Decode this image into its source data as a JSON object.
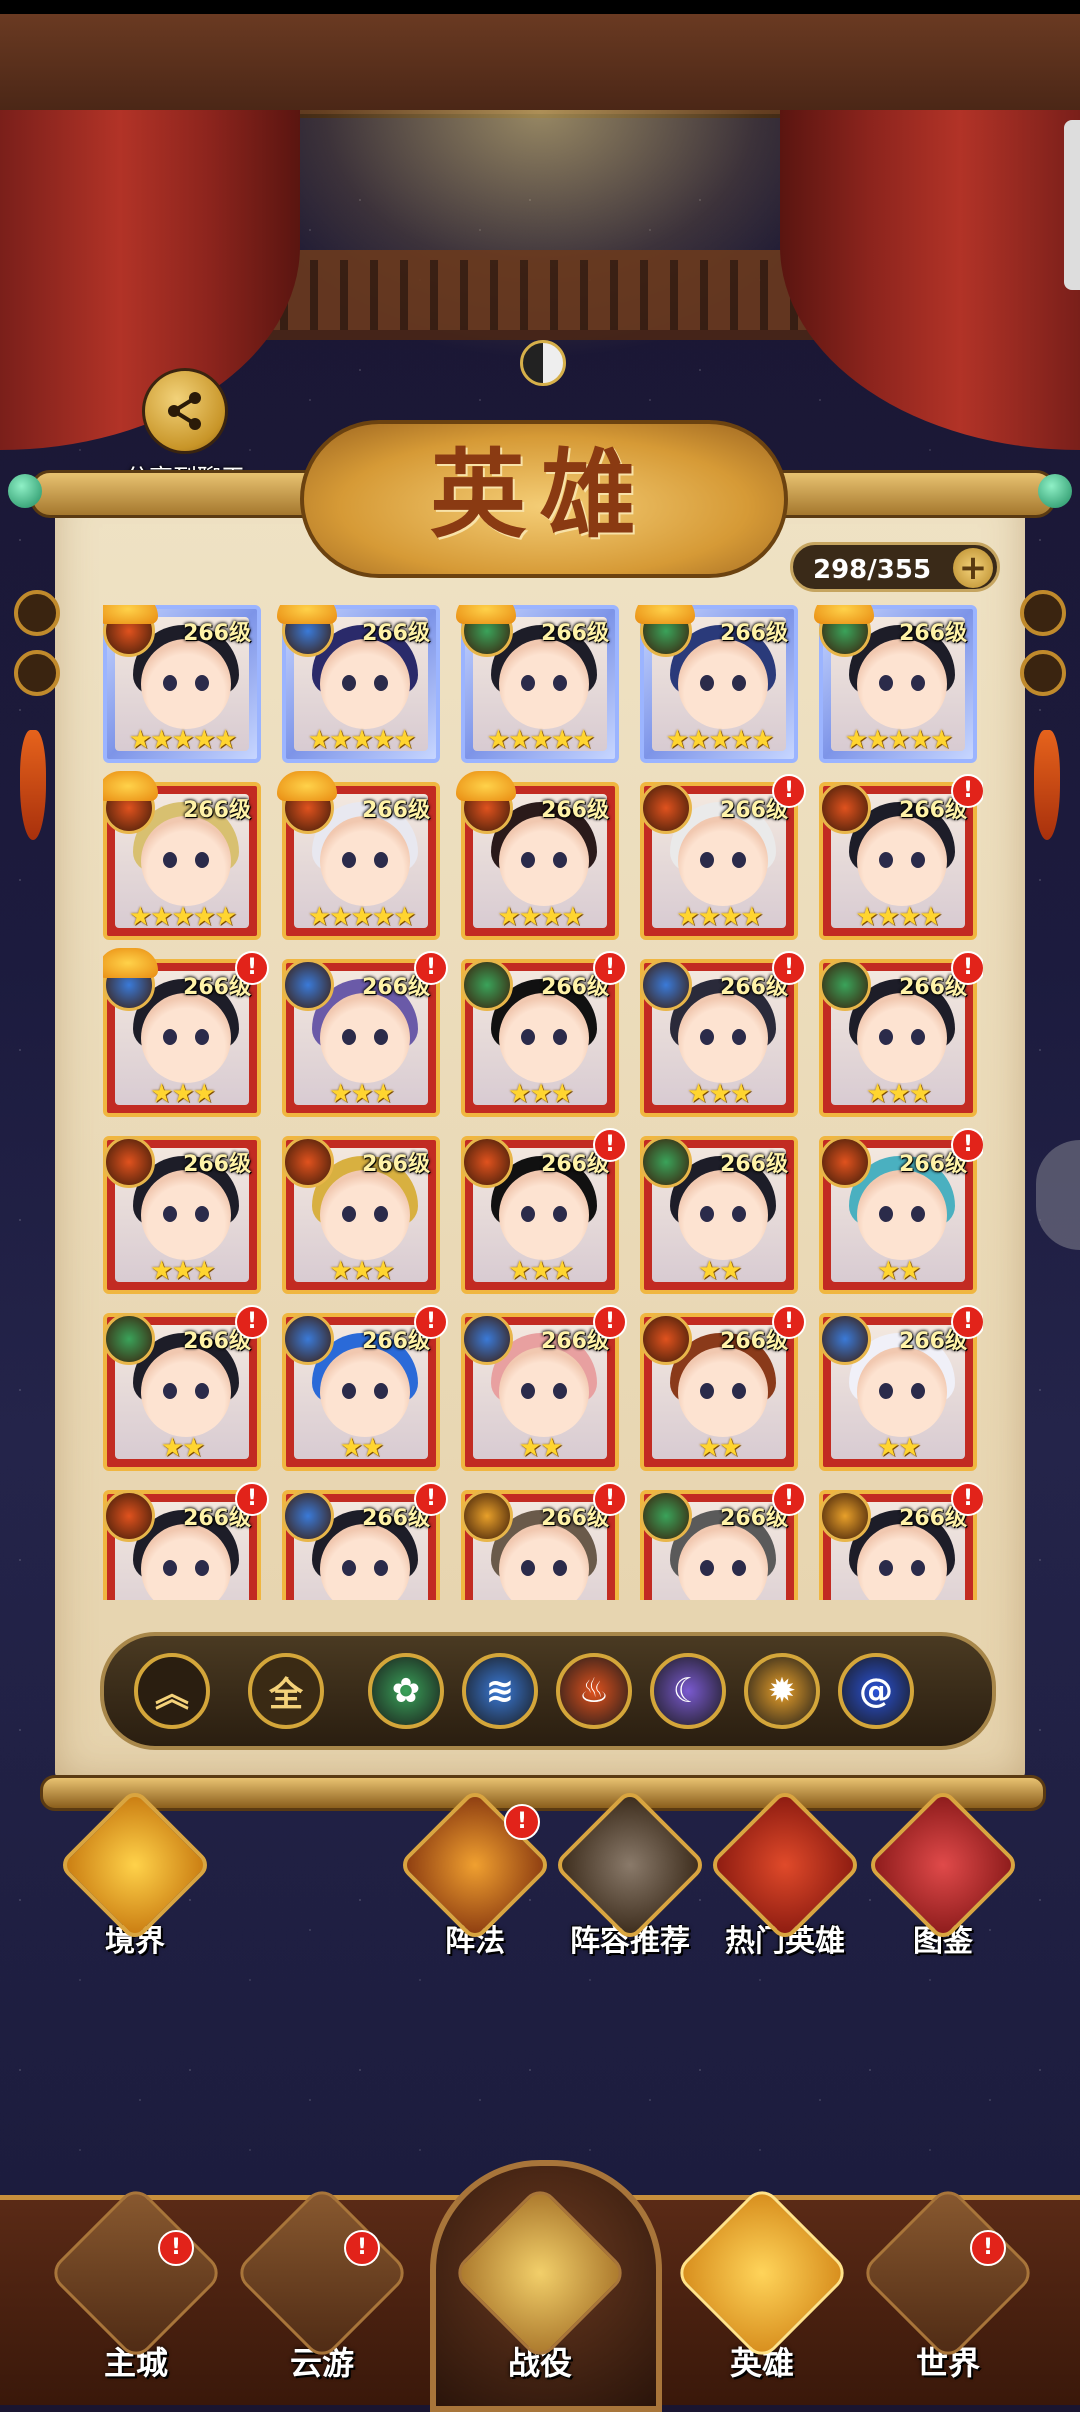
{
  "share": {
    "label": "分享到聊天"
  },
  "title": "英雄",
  "hero_count": "298/355",
  "alert_mark": "!",
  "heroes": [
    {
      "level": "266级",
      "stars": "★★★★★",
      "element": "fire",
      "frame": "gold",
      "ranked": true,
      "alert": false
    },
    {
      "level": "266级",
      "stars": "★★★★★",
      "element": "water",
      "frame": "gold",
      "ranked": true,
      "alert": false
    },
    {
      "level": "266级",
      "stars": "★★★★★",
      "element": "wood",
      "frame": "gold",
      "ranked": true,
      "alert": false
    },
    {
      "level": "266级",
      "stars": "★★★★★",
      "element": "wood",
      "frame": "gold",
      "ranked": true,
      "alert": false
    },
    {
      "level": "266级",
      "stars": "★★★★★",
      "element": "wood",
      "frame": "gold",
      "ranked": true,
      "alert": false
    },
    {
      "level": "266级",
      "stars": "★★★★★",
      "element": "fire",
      "frame": "red",
      "ranked": true,
      "alert": false
    },
    {
      "level": "266级",
      "stars": "★★★★★",
      "element": "fire",
      "frame": "red",
      "ranked": true,
      "alert": false
    },
    {
      "level": "266级",
      "stars": "★★★★",
      "element": "fire",
      "frame": "red",
      "ranked": true,
      "alert": false
    },
    {
      "level": "266级",
      "stars": "★★★★",
      "element": "fire",
      "frame": "red",
      "ranked": false,
      "alert": true
    },
    {
      "level": "266级",
      "stars": "★★★★",
      "element": "fire",
      "frame": "red",
      "ranked": false,
      "alert": true
    },
    {
      "level": "266级",
      "stars": "★★★",
      "element": "water",
      "frame": "red",
      "ranked": true,
      "alert": true
    },
    {
      "level": "266级",
      "stars": "★★★",
      "element": "water",
      "frame": "red",
      "ranked": false,
      "alert": true
    },
    {
      "level": "266级",
      "stars": "★★★",
      "element": "wood",
      "frame": "red",
      "ranked": false,
      "alert": true
    },
    {
      "level": "266级",
      "stars": "★★★",
      "element": "water",
      "frame": "red",
      "ranked": false,
      "alert": true
    },
    {
      "level": "266级",
      "stars": "★★★",
      "element": "wood",
      "frame": "red",
      "ranked": false,
      "alert": true
    },
    {
      "level": "266级",
      "stars": "★★★",
      "element": "fire",
      "frame": "red",
      "ranked": false,
      "alert": false
    },
    {
      "level": "266级",
      "stars": "★★★",
      "element": "fire",
      "frame": "red",
      "ranked": false,
      "alert": false
    },
    {
      "level": "266级",
      "stars": "★★★",
      "element": "fire",
      "frame": "red",
      "ranked": false,
      "alert": true
    },
    {
      "level": "266级",
      "stars": "★★",
      "element": "wood",
      "frame": "red",
      "ranked": false,
      "alert": false
    },
    {
      "level": "266级",
      "stars": "★★",
      "element": "fire",
      "frame": "red",
      "ranked": false,
      "alert": true
    },
    {
      "level": "266级",
      "stars": "★★",
      "element": "wood",
      "frame": "red",
      "ranked": false,
      "alert": true
    },
    {
      "level": "266级",
      "stars": "★★",
      "element": "water",
      "frame": "red",
      "ranked": false,
      "alert": true
    },
    {
      "level": "266级",
      "stars": "★★",
      "element": "water",
      "frame": "red",
      "ranked": false,
      "alert": true
    },
    {
      "level": "266级",
      "stars": "★★",
      "element": "fire",
      "frame": "red",
      "ranked": false,
      "alert": true
    },
    {
      "level": "266级",
      "stars": "★★",
      "element": "water",
      "frame": "red",
      "ranked": false,
      "alert": true
    },
    {
      "level": "266级",
      "stars": "",
      "element": "fire",
      "frame": "red",
      "ranked": false,
      "alert": true
    },
    {
      "level": "266级",
      "stars": "",
      "element": "water",
      "frame": "red",
      "ranked": false,
      "alert": true
    },
    {
      "level": "266级",
      "stars": "",
      "element": "light",
      "frame": "red",
      "ranked": false,
      "alert": true
    },
    {
      "level": "266级",
      "stars": "",
      "element": "wood",
      "frame": "red",
      "ranked": false,
      "alert": true
    },
    {
      "level": "266级",
      "stars": "",
      "element": "light",
      "frame": "red",
      "ranked": false,
      "alert": true
    }
  ],
  "filter": {
    "collapse_icon": "double-chevron-up-icon",
    "all_label": "全",
    "elements": [
      {
        "name": "wood",
        "icon": "leaf-icon",
        "color": "#3aa35a"
      },
      {
        "name": "water",
        "icon": "wave-icon",
        "color": "#3a7ad8"
      },
      {
        "name": "fire",
        "icon": "flame-icon",
        "color": "#e0521e"
      },
      {
        "name": "moon",
        "icon": "crescent-moon-icon",
        "color": "#7a5ad0"
      },
      {
        "name": "light",
        "icon": "sun-icon",
        "color": "#e8a02a"
      },
      {
        "name": "dark",
        "icon": "swirl-icon",
        "color": "#2a52d8"
      }
    ]
  },
  "functions": {
    "realm": {
      "label": "境界"
    },
    "formation": {
      "label": "阵法",
      "alert": "!"
    },
    "recommend": {
      "label": "阵容推荐"
    },
    "popular": {
      "label": "热门英雄"
    },
    "codex": {
      "label": "图鉴"
    }
  },
  "nav": {
    "main_city": {
      "label": "主城",
      "alert": "!"
    },
    "travel": {
      "label": "云游",
      "alert": "!"
    },
    "campaign": {
      "label": "战役"
    },
    "heroes": {
      "label": "英雄"
    },
    "world": {
      "label": "世界",
      "alert": "!"
    }
  },
  "colors": {
    "element_fire": "#e0521e",
    "element_water": "#3a7ad8",
    "element_wood": "#3aa35a",
    "element_light": "#e8a02a"
  }
}
